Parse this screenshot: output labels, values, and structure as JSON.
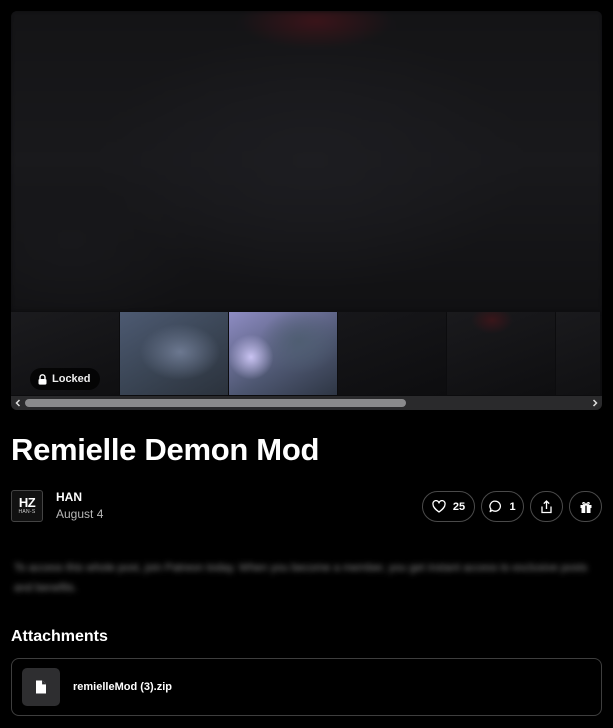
{
  "gallery": {
    "locked_label": "Locked"
  },
  "post": {
    "title": "Remielle Demon Mod",
    "teaser": "To access this whole post, join Patreon today. When you become a member, you get instant access to exclusive posts and benefits."
  },
  "author": {
    "avatar_text": "HZ",
    "avatar_subtext": "HAN-S",
    "name": "HAN",
    "date": "August 4"
  },
  "actions": {
    "likes": "25",
    "comments": "1"
  },
  "attachments": {
    "heading": "Attachments",
    "files": [
      {
        "name": "remielleMod (3).zip"
      }
    ]
  },
  "icons": [
    "lock-icon",
    "chevron-left-icon",
    "chevron-right-icon",
    "heart-icon",
    "comment-icon",
    "share-icon",
    "gift-icon",
    "file-icon"
  ]
}
